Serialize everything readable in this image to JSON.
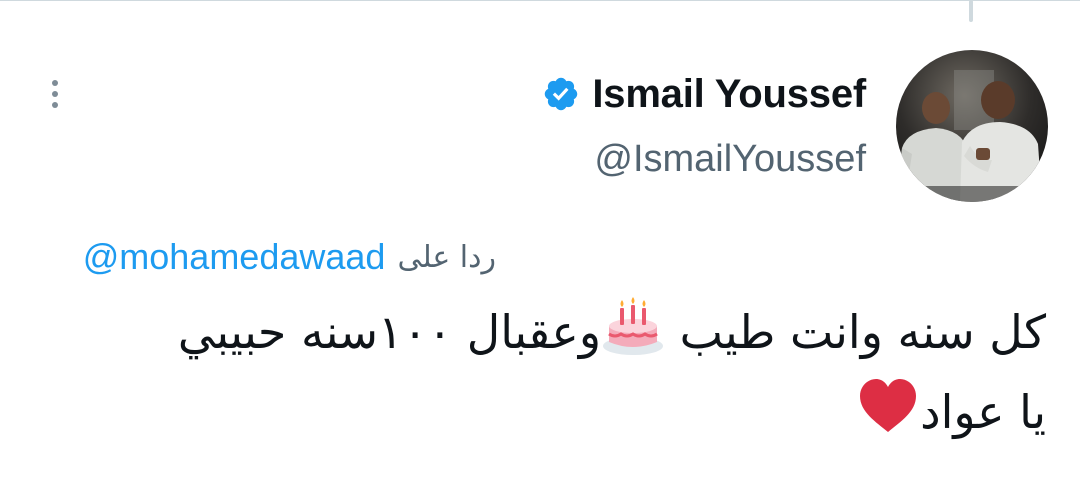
{
  "tweet": {
    "author": {
      "display_name": "Ismail Youssef",
      "handle": "@IsmailYoussef",
      "verified": true
    },
    "reply_prefix": "ردا على",
    "reply_to": "@mohamedawaad",
    "text_line_1a": "كل سنه وانت طيب",
    "text_line_1b": "وعقبال ١٠٠سنه حبيبي",
    "text_line_2": "يا عواد",
    "emoji": [
      "birthday-cake-icon",
      "red-heart-icon"
    ]
  },
  "colors": {
    "text": "#0f1419",
    "secondary": "#536471",
    "link": "#1d9bf0",
    "verified": "#1d9bf0",
    "heart": "#dd2e44"
  }
}
